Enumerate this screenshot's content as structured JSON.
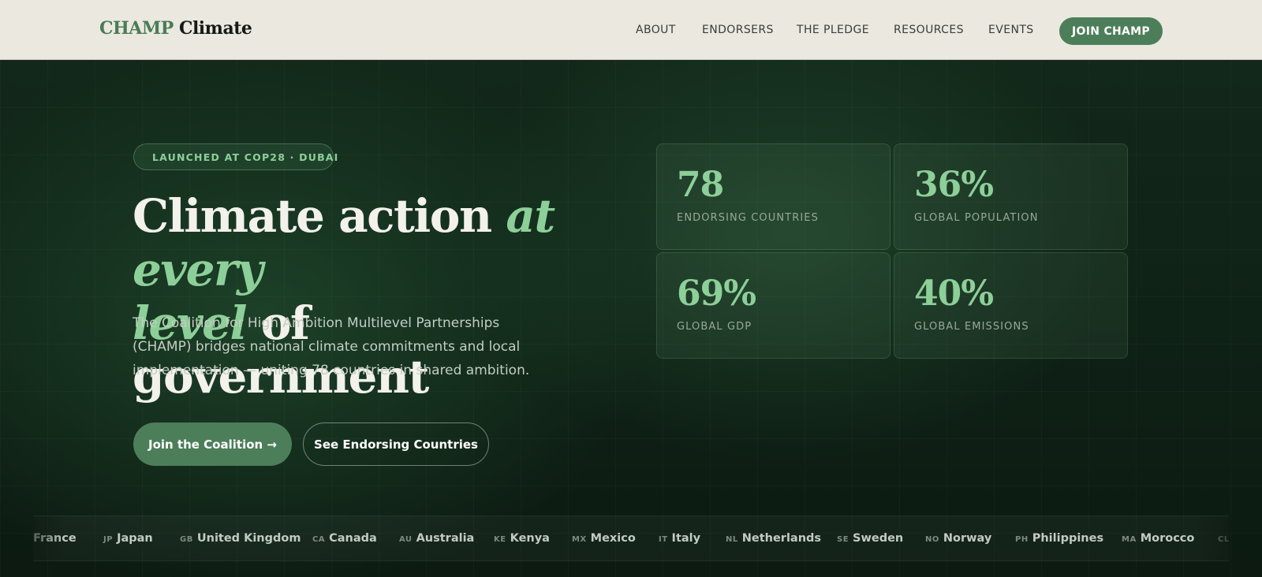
{
  "header": {
    "logo_primary": "CHAMP",
    "logo_secondary": "Climate",
    "nav": [
      "ABOUT",
      "ENDORSERS",
      "THE PLEDGE",
      "RESOURCES",
      "EVENTS"
    ],
    "cta": "JOIN CHAMP"
  },
  "hero": {
    "badge": "LAUNCHED AT COP28 · DUBAI",
    "headline": {
      "part1": "Climate action ",
      "em1": "at every",
      "em2": "level",
      "part2": " of government"
    },
    "lede": "The Coalition for High Ambition Multilevel Partnerships (CHAMP) bridges national climate commitments and local implementation — uniting 78 countries in shared ambition.",
    "primary_button": "Join the Coalition →",
    "secondary_button": "See Endorsing Countries"
  },
  "stats": [
    {
      "value": "78",
      "label": "ENDORSING COUNTRIES"
    },
    {
      "value": "36%",
      "label": "GLOBAL POPULATION"
    },
    {
      "value": "69%",
      "label": "GLOBAL GDP"
    },
    {
      "value": "40%",
      "label": "GLOBAL EMISSIONS"
    }
  ],
  "ticker": [
    {
      "code": "",
      "name": "France"
    },
    {
      "code": "JP",
      "name": "Japan"
    },
    {
      "code": "GB",
      "name": "United Kingdom"
    },
    {
      "code": "CA",
      "name": "Canada"
    },
    {
      "code": "AU",
      "name": "Australia"
    },
    {
      "code": "KE",
      "name": "Kenya"
    },
    {
      "code": "MX",
      "name": "Mexico"
    },
    {
      "code": "IT",
      "name": "Italy"
    },
    {
      "code": "NL",
      "name": "Netherlands"
    },
    {
      "code": "SE",
      "name": "Sweden"
    },
    {
      "code": "NO",
      "name": "Norway"
    },
    {
      "code": "PH",
      "name": "Philippines"
    },
    {
      "code": "MA",
      "name": "Morocco"
    },
    {
      "code": "CL",
      "name": ""
    }
  ]
}
